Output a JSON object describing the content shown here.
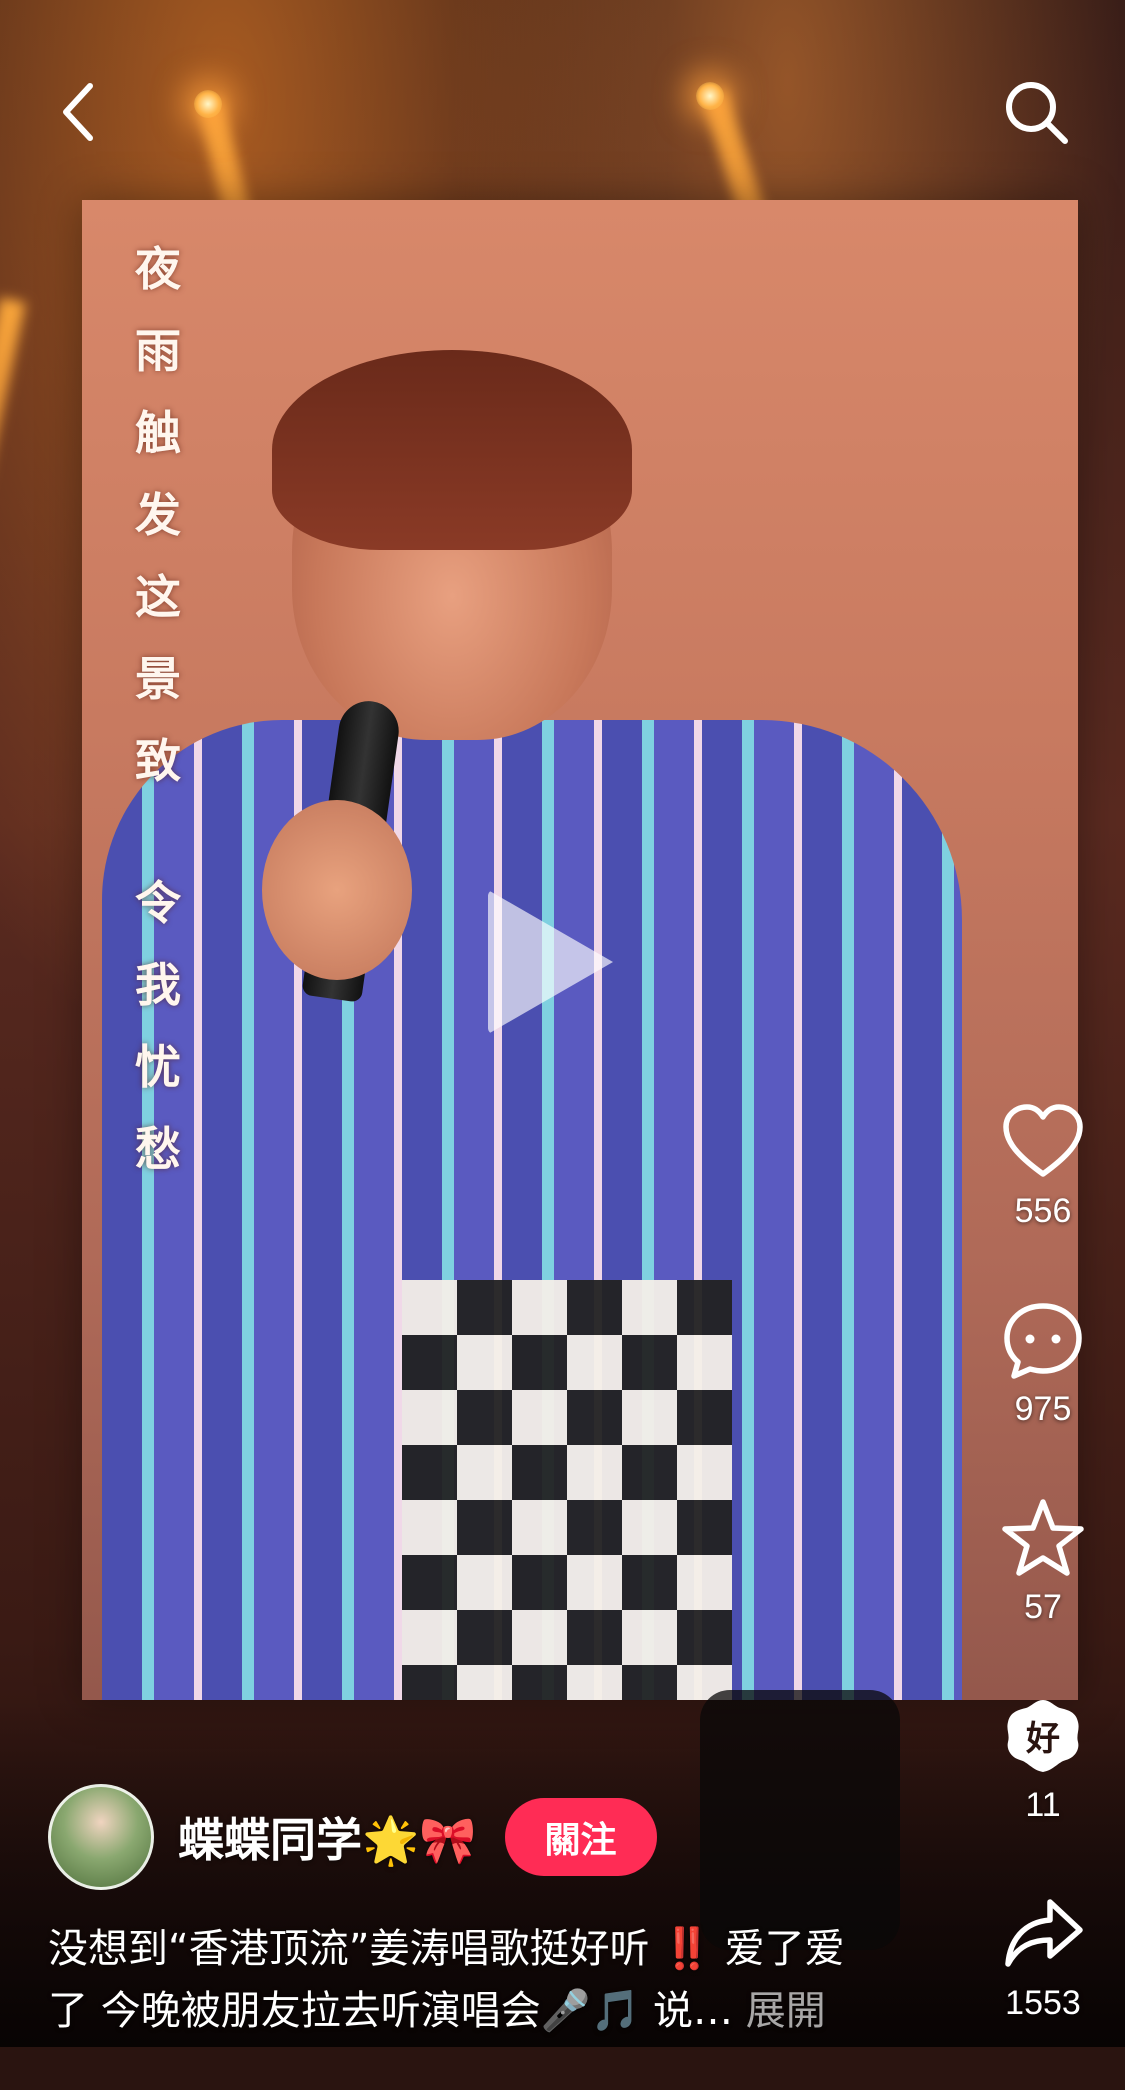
{
  "video": {
    "lyrics": [
      "夜",
      "雨",
      "触",
      "发",
      "这",
      "景",
      "致",
      "令",
      "我",
      "忧",
      "愁"
    ]
  },
  "top_bar": {
    "back_icon": "chevron-left-icon",
    "search_icon": "search-icon"
  },
  "actions": {
    "like_count": "556",
    "comment_count": "975",
    "favorite_count": "57",
    "share_custom_count": "11",
    "share_count": "1553"
  },
  "author": {
    "name": "蝶蝶同学🌟🎀",
    "follow_label": "關注"
  },
  "caption": {
    "text_line1": "没想到“香港顶流”姜涛唱歌挺好听 ‼️ 爱了爱",
    "text_line2": "了 今晚被朋友拉去听演唱会🎤🎵 说…",
    "expand_label": "展開"
  },
  "colors": {
    "follow_button": "#ff2c55",
    "stage_light": "#ffb347"
  }
}
